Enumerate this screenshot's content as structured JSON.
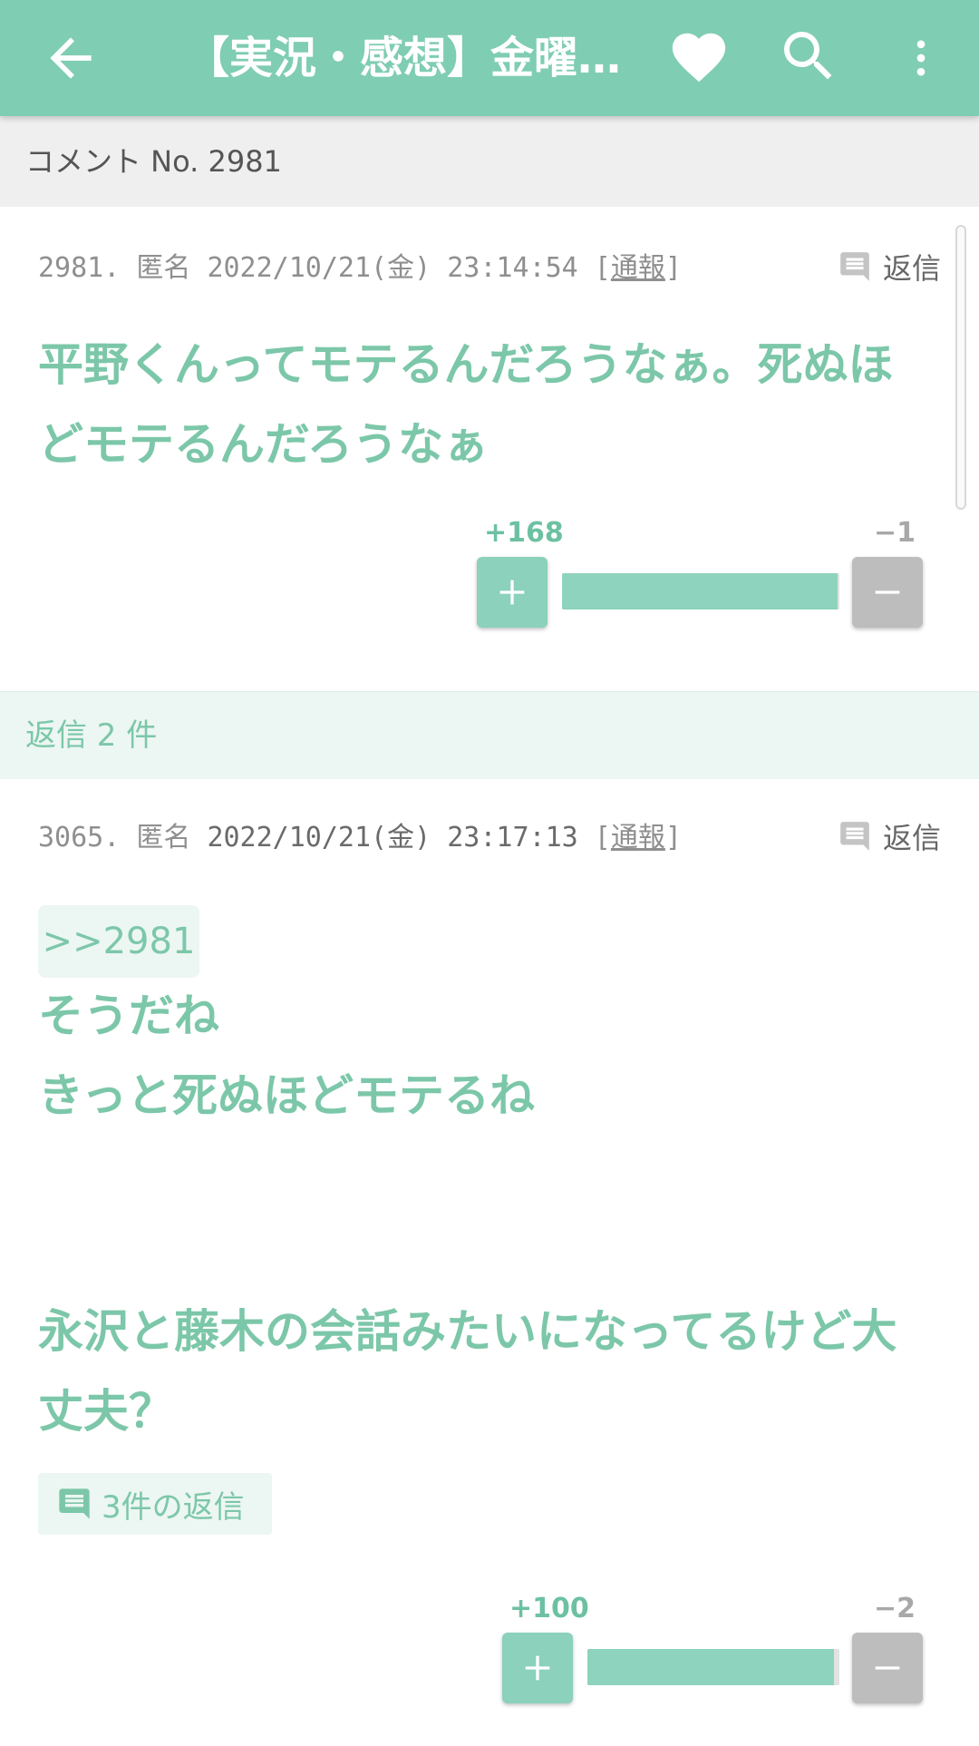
{
  "appbar": {
    "title": "【実況・感想】金曜…",
    "icons": [
      "back-arrow-icon",
      "heart-icon",
      "search-icon",
      "more-vert-icon"
    ],
    "accent_color": "#7fcdb2"
  },
  "subheader": {
    "label": "コメント No. 2981"
  },
  "comment": {
    "number": "2981.",
    "author": "匿名",
    "datetime": "2022/10/21(金) 23:14:54",
    "report_open": "[",
    "report_label": "通報",
    "report_close": "]",
    "reply_label": "返信",
    "body_line1": "平野くんってモテるんだろうなぁ。死ぬほ",
    "body_line2": "どモテるんだろうなぁ",
    "plus_count": "+168",
    "minus_count": "−1",
    "plus_share": 0.994
  },
  "replies_header": {
    "label": "返信 2 件"
  },
  "reply": {
    "number": "3065.",
    "author": "匿名",
    "datetime": "2022/10/21(金) 23:17:13",
    "report_open": "[",
    "report_label": "通報",
    "report_close": "]",
    "reply_label": "返信",
    "anchor": ">>2981",
    "line1": "そうだね",
    "line2": "きっと死ぬほどモテるね",
    "line3": "永沢と藤木の会話みたいになってるけど大",
    "line4": "丈夫？",
    "replies_count_label": "3件の返信",
    "plus_count": "+100",
    "minus_count": "−2",
    "plus_share": 0.98
  }
}
